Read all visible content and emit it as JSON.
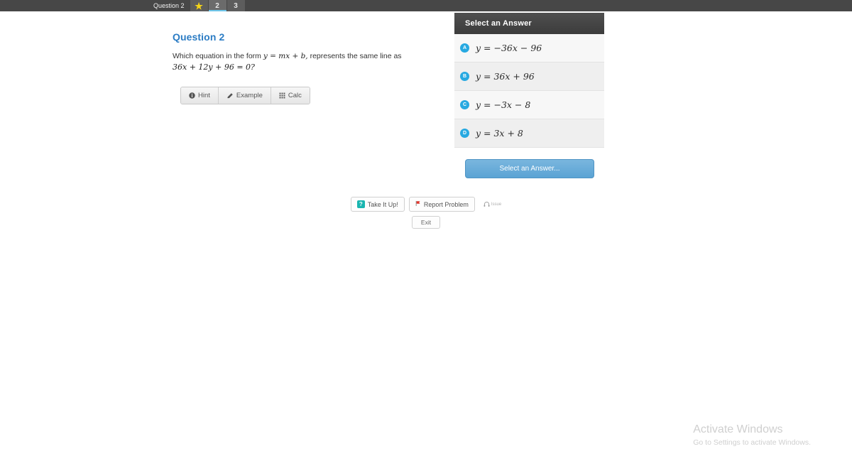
{
  "topbar": {
    "title": "Question 2",
    "tabs": [
      {
        "label": "★",
        "type": "star",
        "active": false
      },
      {
        "label": "2",
        "type": "number",
        "active": true
      },
      {
        "label": "3",
        "type": "number",
        "active": false
      }
    ]
  },
  "question": {
    "heading": "Question 2",
    "prompt_part1": "Which equation in the form ",
    "prompt_math_inline": "y = mx + b,",
    "prompt_part2": " represents the same line as",
    "prompt_math_block": "36x + 12y + 96 = 0?"
  },
  "tools": [
    {
      "label": "Hint",
      "icon": "info-icon"
    },
    {
      "label": "Example",
      "icon": "pencil-icon"
    },
    {
      "label": "Calc",
      "icon": "grid-icon"
    }
  ],
  "answer_panel": {
    "header": "Select an Answer",
    "options": [
      {
        "letter": "A",
        "text": "y = −36x − 96"
      },
      {
        "letter": "B",
        "text": "y = 36x + 96"
      },
      {
        "letter": "C",
        "text": "y = −3x − 8"
      },
      {
        "letter": "D",
        "text": "y = 3x + 8"
      }
    ],
    "submit_label": "Select an Answer..."
  },
  "bottom_toolbar": {
    "take_it_up": "Take It Up!",
    "take_it_up_badge": "?",
    "report_problem": "Report Problem",
    "audio_label": "Issue",
    "exit": "Exit"
  },
  "watermark": {
    "title": "Activate Windows",
    "subtitle": "Go to Settings to activate Windows."
  },
  "colors": {
    "topbar_bg": "#474747",
    "tab_active_underline": "#6ec5e8",
    "question_heading": "#2b7cc4",
    "badge_blue": "#27a9e1",
    "submit_blue": "#5aa3d4",
    "flag_red": "#e0352b",
    "qbadge_teal": "#19b5b0",
    "star_yellow": "#f5d417"
  }
}
